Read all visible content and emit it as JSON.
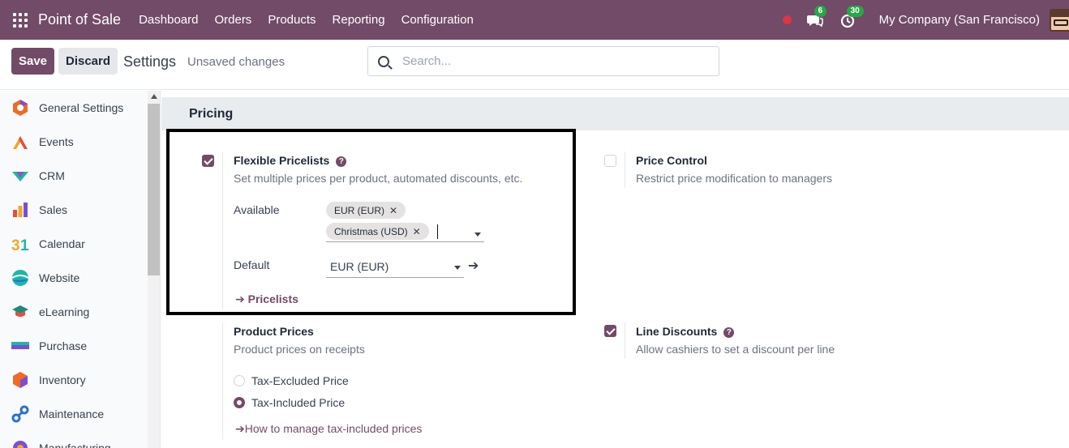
{
  "navbar": {
    "brand": "Point of Sale",
    "menu": [
      "Dashboard",
      "Orders",
      "Products",
      "Reporting",
      "Configuration"
    ],
    "messages_badge": "6",
    "activities_badge": "30",
    "company": "My Company (San Francisco)"
  },
  "control_panel": {
    "save_label": "Save",
    "discard_label": "Discard",
    "title": "Settings",
    "status": "Unsaved changes",
    "search_placeholder": "Search..."
  },
  "sidebar": {
    "items": [
      {
        "label": "General Settings",
        "icon": "general-settings-icon"
      },
      {
        "label": "Events",
        "icon": "events-icon"
      },
      {
        "label": "CRM",
        "icon": "crm-icon"
      },
      {
        "label": "Sales",
        "icon": "sales-icon"
      },
      {
        "label": "Calendar",
        "icon": "calendar-icon"
      },
      {
        "label": "Website",
        "icon": "website-icon"
      },
      {
        "label": "eLearning",
        "icon": "elearning-icon"
      },
      {
        "label": "Purchase",
        "icon": "purchase-icon"
      },
      {
        "label": "Inventory",
        "icon": "inventory-icon"
      },
      {
        "label": "Maintenance",
        "icon": "maintenance-icon"
      },
      {
        "label": "Manufacturing",
        "icon": "manufacturing-icon"
      }
    ]
  },
  "pricing": {
    "section_title": "Pricing",
    "flexible_pricelists": {
      "title": "Flexible Pricelists",
      "checked": true,
      "description": "Set multiple prices per product, automated discounts, etc.",
      "available_label": "Available",
      "available_tags": [
        "EUR (EUR)",
        "Christmas (USD)"
      ],
      "default_label": "Default",
      "default_value": "EUR (EUR)",
      "pricelists_link": "Pricelists"
    },
    "price_control": {
      "title": "Price Control",
      "checked": false,
      "description": "Restrict price modification to managers"
    },
    "product_prices": {
      "title": "Product Prices",
      "description": "Product prices on receipts",
      "options": [
        "Tax-Excluded Price",
        "Tax-Included Price"
      ],
      "selected": "Tax-Included Price",
      "help_link": "How to manage tax-included prices"
    },
    "line_discounts": {
      "title": "Line Discounts",
      "checked": true,
      "description": "Allow cashiers to set a discount per line"
    }
  },
  "colors": {
    "brand": "#714B67",
    "highlight_border": "#000000"
  }
}
